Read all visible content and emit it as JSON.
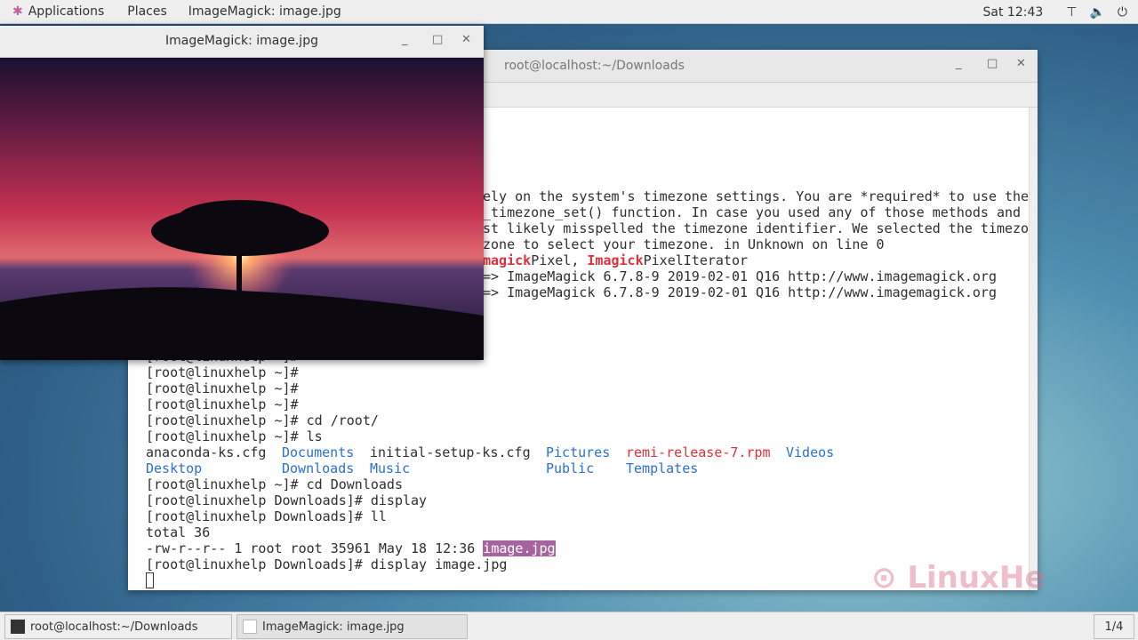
{
  "topbar": {
    "applications": "Applications",
    "places": "Places",
    "window": "ImageMagick: image.jpg",
    "clock": "Sat 12:43",
    "icons": [
      "network-icon",
      "volume-icon",
      "power-icon"
    ]
  },
  "terminal": {
    "title": "root@localhost:~/Downloads",
    "partial_lines": [
      "ely on the system's timezone settings. You are *required* to use the",
      "_timezone_set() function. In case you used any of those methods and",
      "st likely misspelled the timezone identifier. We selected the timezo",
      "zone to select your timezone. in Unknown on line 0"
    ],
    "imagick_line": {
      "a": "magick",
      "b": "Pixel, ",
      "c": "Imagick",
      "d": "PixelIterator"
    },
    "version_lines": [
      "=> ImageMagick 6.7.8-9 2019-02-01 Q16 http://www.imagemagick.org",
      "=> ImageMagick 6.7.8-9 2019-02-01 Q16 http://www.imagemagick.org"
    ],
    "prompts": [
      "[root@linuxhelp ~]#",
      "[root@linuxhelp ~]#",
      "[root@linuxhelp ~]#",
      "[root@linuxhelp ~]#",
      "[root@linuxhelp ~]# cd /root/",
      "[root@linuxhelp ~]# ls"
    ],
    "ls": {
      "anaconda": "anaconda-ks.cfg",
      "documents": "Documents",
      "initial": "initial-setup-ks.cfg",
      "pictures": "Pictures",
      "remi": "remi-release-7.rpm",
      "videos": "Videos",
      "desktop": "Desktop",
      "downloads": "Downloads",
      "music": "Music",
      "public": "Public",
      "templates": "Templates"
    },
    "after": [
      "[root@linuxhelp ~]# cd Downloads",
      "[root@linuxhelp Downloads]# display",
      "[root@linuxhelp Downloads]# ll",
      "total 36"
    ],
    "file_line": {
      "meta": "-rw-r--r-- 1 root root 35961 May 18 12:36 ",
      "name": "image.jpg"
    },
    "last": "[root@linuxhelp Downloads]# display image.jpg"
  },
  "imagewin": {
    "title": "ImageMagick: image.jpg"
  },
  "taskbar": {
    "items": [
      "root@localhost:~/Downloads",
      "ImageMagick: image.jpg"
    ],
    "workspace": "1/4"
  },
  "watermark": "LinuxHelp",
  "colors": {
    "dir": "#2a6fd6",
    "archive": "#e0303a",
    "highlight": "#a6649e"
  }
}
